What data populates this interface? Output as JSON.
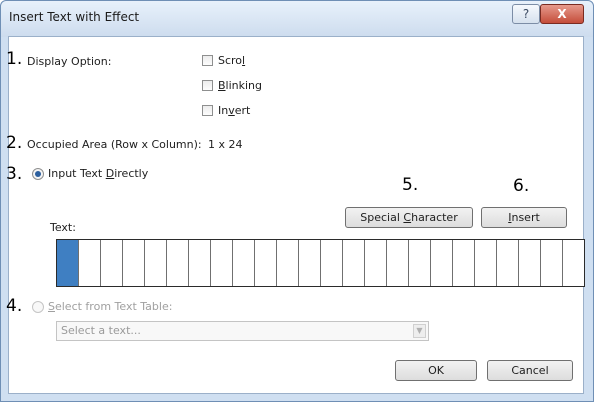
{
  "window": {
    "title": "Insert Text with Effect",
    "help_label": "?",
    "close_label": "X"
  },
  "markers": [
    "1.",
    "2.",
    "3.",
    "4.",
    "5.",
    "6."
  ],
  "display_option": {
    "label": "Display Option:",
    "options": [
      {
        "pre": "Scro",
        "key": "l",
        "post": "",
        "checked": false
      },
      {
        "pre": "",
        "key": "B",
        "post": "linking",
        "checked": false
      },
      {
        "pre": "In",
        "key": "v",
        "post": "ert",
        "checked": false
      }
    ]
  },
  "occupied_area": {
    "label": "Occupied Area (Row x Column):",
    "value": "1 x 24"
  },
  "input_direct": {
    "pre": "Input Text ",
    "key": "D",
    "post": "irectly",
    "selected": true
  },
  "text_section": {
    "label": "Text:",
    "special_pre": "Special ",
    "special_key": "C",
    "special_post": "haracter",
    "insert_key": "I",
    "insert_post": "nsert",
    "cell_count": 24,
    "selected_cell": 0
  },
  "text_table": {
    "key": "S",
    "post": "elect from Text Table:",
    "selected": false,
    "enabled": false,
    "select_placeholder": "Select a text..."
  },
  "footer": {
    "ok_label": "OK",
    "cancel_label": "Cancel"
  },
  "colors": {
    "selected_cell": "#3f7fc2",
    "close_button": "#c44d3a"
  }
}
